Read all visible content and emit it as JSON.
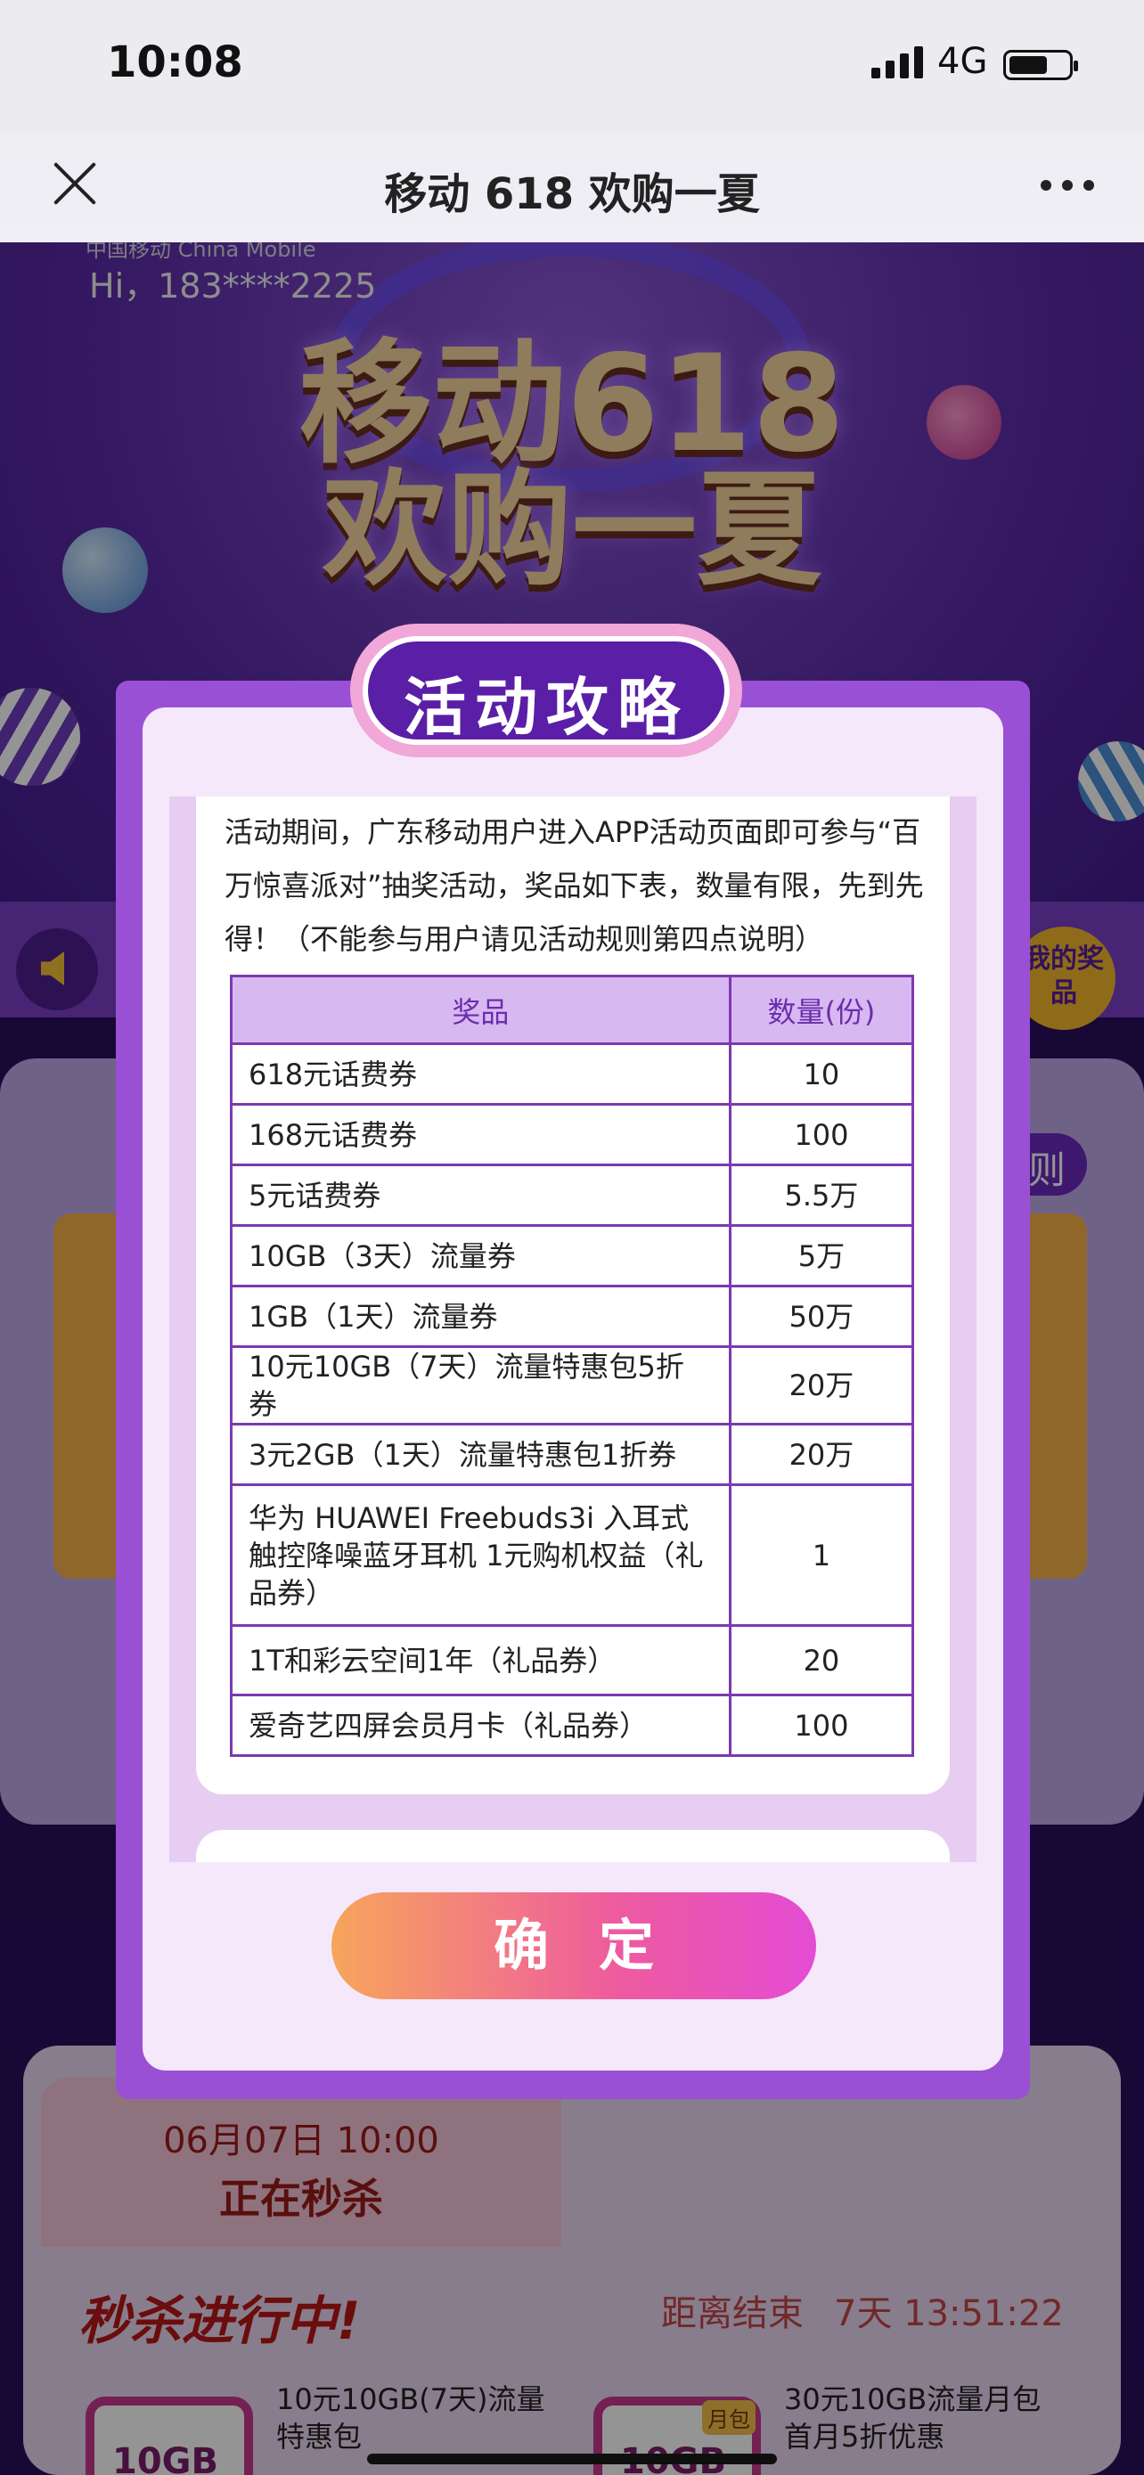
{
  "status_bar": {
    "time": "10:08",
    "network": "4G"
  },
  "nav": {
    "title": "移动 618 欢购一夏"
  },
  "banner": {
    "carrier_logo": "中国移动 China Mobile",
    "greeting": "Hi，183****2225",
    "headline_line1": "移动618",
    "headline_line2": "欢购一夏",
    "my_prizes_label": "我的奖品",
    "rules_tag": "则"
  },
  "flash_sale": {
    "date": "06月07日 10:00",
    "status": "正在秒杀",
    "heading": "秒杀进行中!",
    "countdown_label": "距离结束",
    "countdown_value": "7天 13:51:22",
    "products": [
      {
        "badge": "10GB",
        "name_line1": "10元10GB(7天)流量",
        "name_line2": "特惠包"
      },
      {
        "badge": "10GB",
        "tag": "月包",
        "name_line1": "30元10GB流量月包",
        "name_line2": "首月5折优惠"
      }
    ]
  },
  "modal": {
    "title": "活动攻略",
    "intro": "活动期间，广东移动用户进入APP活动页面即可参与“百万惊喜派对”抽奖活动，奖品如下表，数量有限，先到先得！（不能参与用户请见活动规则第四点说明）",
    "table": {
      "headers": [
        "奖品",
        "数量(份)"
      ],
      "rows": [
        {
          "prize": "618元话费券",
          "qty": "10"
        },
        {
          "prize": "168元话费券",
          "qty": "100"
        },
        {
          "prize": "5元话费券",
          "qty": "5.5万"
        },
        {
          "prize": "10GB（3天）流量券",
          "qty": "5万"
        },
        {
          "prize": "1GB（1天）流量券",
          "qty": "50万"
        },
        {
          "prize": "10元10GB（7天）流量特惠包5折券",
          "qty": "20万"
        },
        {
          "prize": "3元2GB（1天）流量特惠包1折券",
          "qty": "20万"
        },
        {
          "prize": "华为 HUAWEI Freebuds3i 入耳式触控降噪蓝牙耳机 1元购机权益（礼品券）",
          "qty": "1"
        },
        {
          "prize": "1T和彩云空间1年（礼品券）",
          "qty": "20"
        },
        {
          "prize": "爱奇艺四屏会员月卡（礼品券）",
          "qty": "100"
        }
      ]
    },
    "confirm_label": "确定"
  },
  "colors": {
    "accent": "#9a50d4",
    "title_badge": "#5a1fa6",
    "table_border": "#7b3ab0",
    "header_fill": "#d8b8f0"
  },
  "icons": [
    "close-icon",
    "more-icon",
    "speaker-icon",
    "signal-icon",
    "battery-icon"
  ]
}
